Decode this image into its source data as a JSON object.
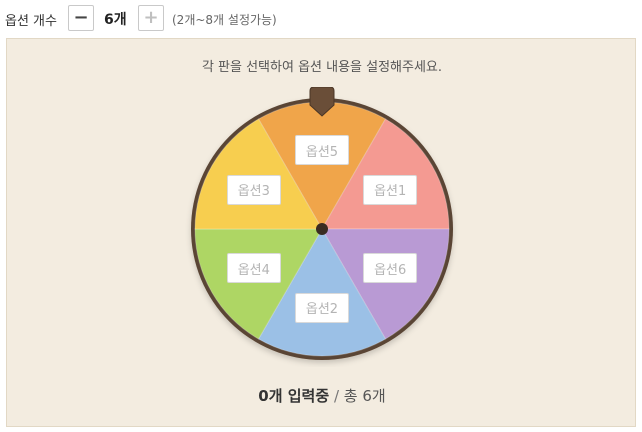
{
  "topbar": {
    "label": "옵션 개수",
    "minus_icon": "minus-icon",
    "count": "6",
    "count_unit": "개",
    "plus_icon": "plus-icon",
    "hint": "(2개~8개 설정가능)"
  },
  "panel": {
    "instruction": "각 판을 선택하여 옵션 내용을 설정해주세요.",
    "slices": [
      {
        "label": "옵션5",
        "color": "#f0a54a"
      },
      {
        "label": "옵션1",
        "color": "#f49a92"
      },
      {
        "label": "옵션6",
        "color": "#b99ad4"
      },
      {
        "label": "옵션2",
        "color": "#9bc0e6"
      },
      {
        "label": "옵션4",
        "color": "#aed664"
      },
      {
        "label": "옵션3",
        "color": "#f7ce4f"
      }
    ],
    "rim_color": "#5a4534",
    "status_current": "0개 입력중",
    "status_sep": " / ",
    "status_total": "총 6개"
  }
}
